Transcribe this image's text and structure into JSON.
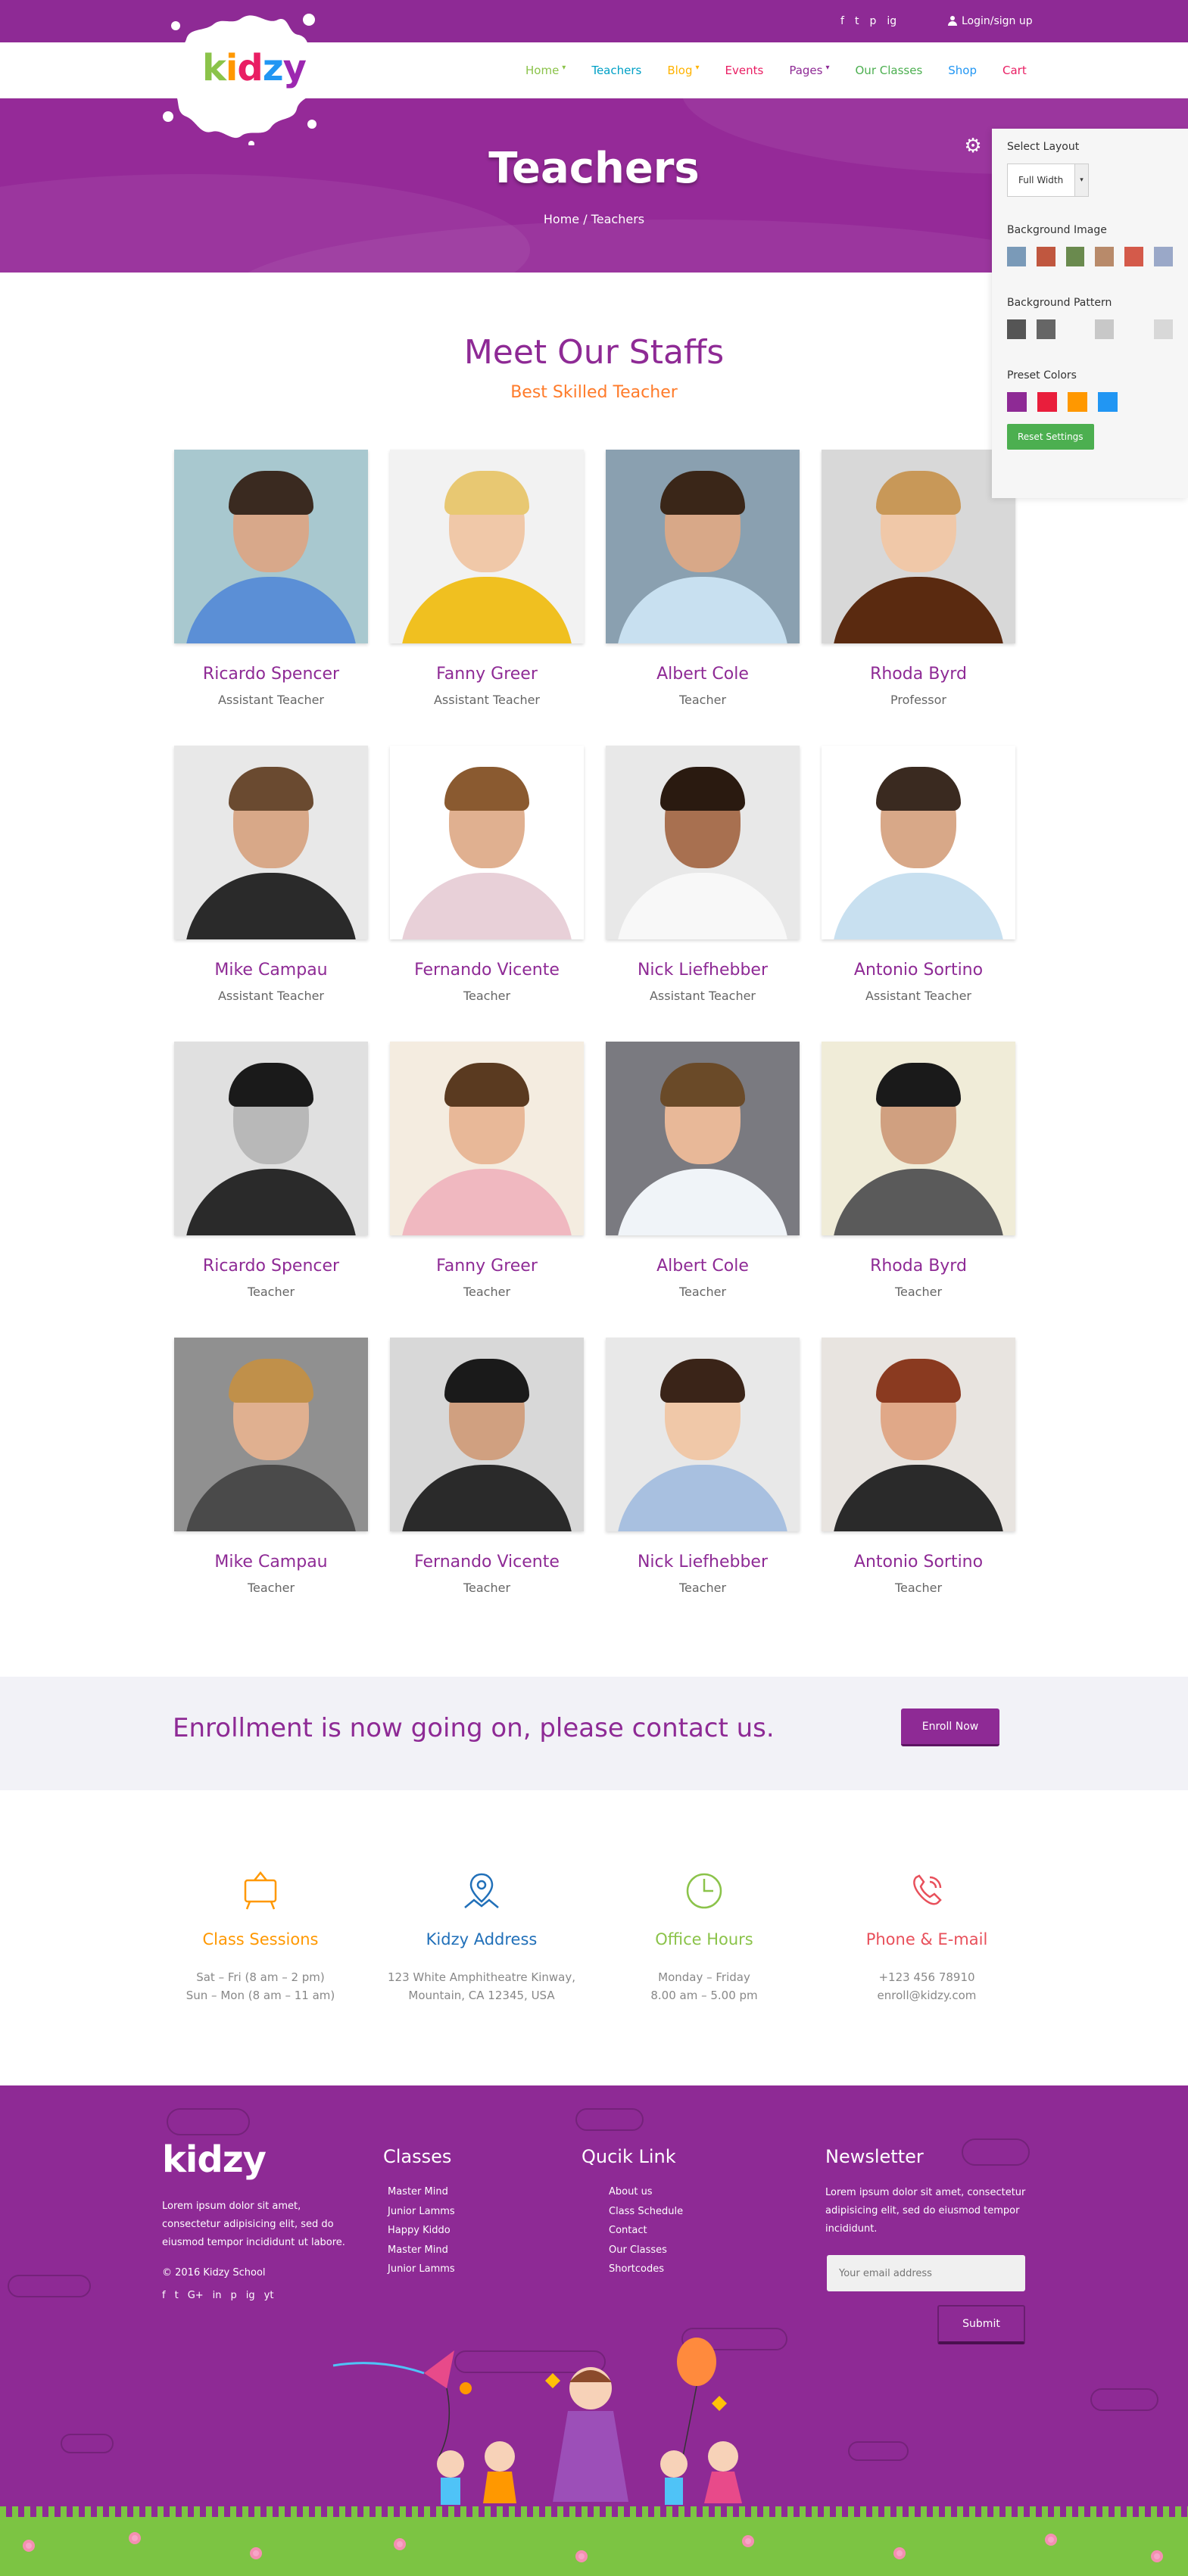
{
  "topbar": {
    "social": [
      "f",
      "t",
      "p",
      "ig"
    ],
    "login_label": "Login/sign up"
  },
  "logo": {
    "letters": [
      "k",
      "i",
      "d",
      "z",
      "y"
    ]
  },
  "nav": {
    "items": [
      {
        "label": "Home",
        "color": "#8bc34a",
        "caret": true
      },
      {
        "label": "Teachers",
        "color": "#00a0c6",
        "caret": false
      },
      {
        "label": "Blog",
        "color": "#ffb300",
        "caret": true
      },
      {
        "label": "Events",
        "color": "#e91e63",
        "caret": false
      },
      {
        "label": "Pages",
        "color": "#8e2a95",
        "caret": true
      },
      {
        "label": "Our Classes",
        "color": "#4caf50",
        "caret": false
      },
      {
        "label": "Shop",
        "color": "#2196f3",
        "caret": false
      },
      {
        "label": "Cart",
        "color": "#e91e63",
        "caret": false
      }
    ]
  },
  "hero": {
    "title": "Teachers",
    "breadcrumb": "Home / Teachers"
  },
  "settings_panel": {
    "layout_label": "Select Layout",
    "layout_value": "Full Width",
    "bg_image_label": "Background Image",
    "bg_images": [
      "#7a9ab8",
      "#c0573f",
      "#6a8a4e",
      "#b88a6a",
      "#d45a4a",
      "#9aa8c8"
    ],
    "bg_pattern_label": "Background Pattern",
    "patterns": [
      "#555555",
      "#666666",
      "#f6f6f6",
      "#c8c8c8",
      "#f6f6f6",
      "#d8d8d8"
    ],
    "preset_label": "Preset Colors",
    "presets": [
      "#8e2a95",
      "#e91e3c",
      "#ff9800",
      "#2196f3"
    ],
    "reset_label": "Reset Settings"
  },
  "section": {
    "title": "Meet Our Staffs",
    "subtitle": "Best Skilled Teacher"
  },
  "teachers": [
    {
      "name": "Ricardo Spencer",
      "role": "Assistant Teacher",
      "bg": "#a8c8cf",
      "skin": "#d8a88a",
      "hair": "#3a2a20",
      "shirt": "#5b8fd6"
    },
    {
      "name": "Fanny Greer",
      "role": "Assistant Teacher",
      "bg": "#f2f2f2",
      "skin": "#f0c8a8",
      "hair": "#e8c872",
      "shirt": "#f0c020"
    },
    {
      "name": "Albert Cole",
      "role": "Teacher",
      "bg": "#8aa0b0",
      "skin": "#d8a888",
      "hair": "#3a2618",
      "shirt": "#c8e0f0"
    },
    {
      "name": "Rhoda Byrd",
      "role": "Professor",
      "bg": "#d8d8d8",
      "skin": "#f0c8a8",
      "hair": "#c89858",
      "shirt": "#5a2a10"
    },
    {
      "name": "Mike Campau",
      "role": "Assistant Teacher",
      "bg": "#e8e8e8",
      "skin": "#d8a888",
      "hair": "#6a4a30",
      "shirt": "#2a2a2a"
    },
    {
      "name": "Fernando Vicente",
      "role": "Teacher",
      "bg": "#ffffff",
      "skin": "#e0b090",
      "hair": "#8a5a30",
      "shirt": "#e8d0d8"
    },
    {
      "name": "Nick Liefhebber",
      "role": "Assistant Teacher",
      "bg": "#e8e8e8",
      "skin": "#a87050",
      "hair": "#2a1a10",
      "shirt": "#f8f8f8"
    },
    {
      "name": "Antonio Sortino",
      "role": "Assistant Teacher",
      "bg": "#ffffff",
      "skin": "#d8a888",
      "hair": "#3a2a20",
      "shirt": "#c8e0f0"
    },
    {
      "name": "Ricardo Spencer",
      "role": "Teacher",
      "bg": "#e0e0e0",
      "skin": "#b8b8b8",
      "hair": "#1a1a1a",
      "shirt": "#2a2a2a"
    },
    {
      "name": "Fanny Greer",
      "role": "Teacher",
      "bg": "#f4ece0",
      "skin": "#e8b898",
      "hair": "#5a3a20",
      "shirt": "#f0b8c0"
    },
    {
      "name": "Albert Cole",
      "role": "Teacher",
      "bg": "#7a7a80",
      "skin": "#e8b898",
      "hair": "#6a4a28",
      "shirt": "#f0f4f8"
    },
    {
      "name": "Rhoda Byrd",
      "role": "Teacher",
      "bg": "#f0ecd8",
      "skin": "#d0a080",
      "hair": "#1a1a1a",
      "shirt": "#5a5a5a"
    },
    {
      "name": "Mike Campau",
      "role": "Teacher",
      "bg": "#909090",
      "skin": "#e0b090",
      "hair": "#c0904a",
      "shirt": "#4a4a4a"
    },
    {
      "name": "Fernando Vicente",
      "role": "Teacher",
      "bg": "#d8d8d8",
      "skin": "#d0a080",
      "hair": "#1a1a1a",
      "shirt": "#2a2a2a"
    },
    {
      "name": "Nick Liefhebber",
      "role": "Teacher",
      "bg": "#e8e8e8",
      "skin": "#f0c8a8",
      "hair": "#3a2418",
      "shirt": "#a8c0e0"
    },
    {
      "name": "Antonio Sortino",
      "role": "Teacher",
      "bg": "#e8e4e0",
      "skin": "#e0a888",
      "hair": "#8a3a20",
      "shirt": "#2a2a2a"
    }
  ],
  "enroll": {
    "text": "Enrollment is now going on, please contact us.",
    "button": "Enroll Now"
  },
  "info": [
    {
      "title": "Class Sessions",
      "color": "#ff9800",
      "line1": "Sat – Fri (8 am – 2 pm)",
      "line2": "Sun – Mon (8 am – 11 am)",
      "icon": "board-icon"
    },
    {
      "title": "Kidzy Address",
      "color": "#2170b9",
      "line1": "123 White Amphitheatre Kinway,",
      "line2": "Mountain, CA 12345, USA",
      "icon": "map-pin-icon"
    },
    {
      "title": "Office Hours",
      "color": "#8bc34a",
      "line1": "Monday – Friday",
      "line2": "8.00 am – 5.00 pm",
      "icon": "clock-icon"
    },
    {
      "title": "Phone & E-mail",
      "color": "#e8505b",
      "line1": "+123 456 78910",
      "line2": "enroll@kidzy.com",
      "icon": "phone-icon"
    }
  ],
  "footer": {
    "logo": "kidzy",
    "about": "Lorem ipsum dolor sit amet, consectetur adipisicing elit, sed do eiusmod tempor incididunt ut labore.",
    "copyright": "© 2016 Kidzy School",
    "social": [
      "f",
      "t",
      "G+",
      "in",
      "p",
      "ig",
      "yt"
    ],
    "classes_title": "Classes",
    "classes": [
      "Master Mind",
      "Junior Lamms",
      "Happy Kiddo",
      "Master Mind",
      "Junior Lamms"
    ],
    "quick_title": "Qucik Link",
    "quick": [
      "About us",
      "Class Schedule",
      "Contact",
      "Our Classes",
      "Shortcodes"
    ],
    "news_title": "Newsletter",
    "news_text": "Lorem ipsum dolor sit amet, consectetur adipisicing elit, sed do eiusmod tempor incididunt.",
    "email_placeholder": "Your email address",
    "submit_label": "Submit"
  }
}
